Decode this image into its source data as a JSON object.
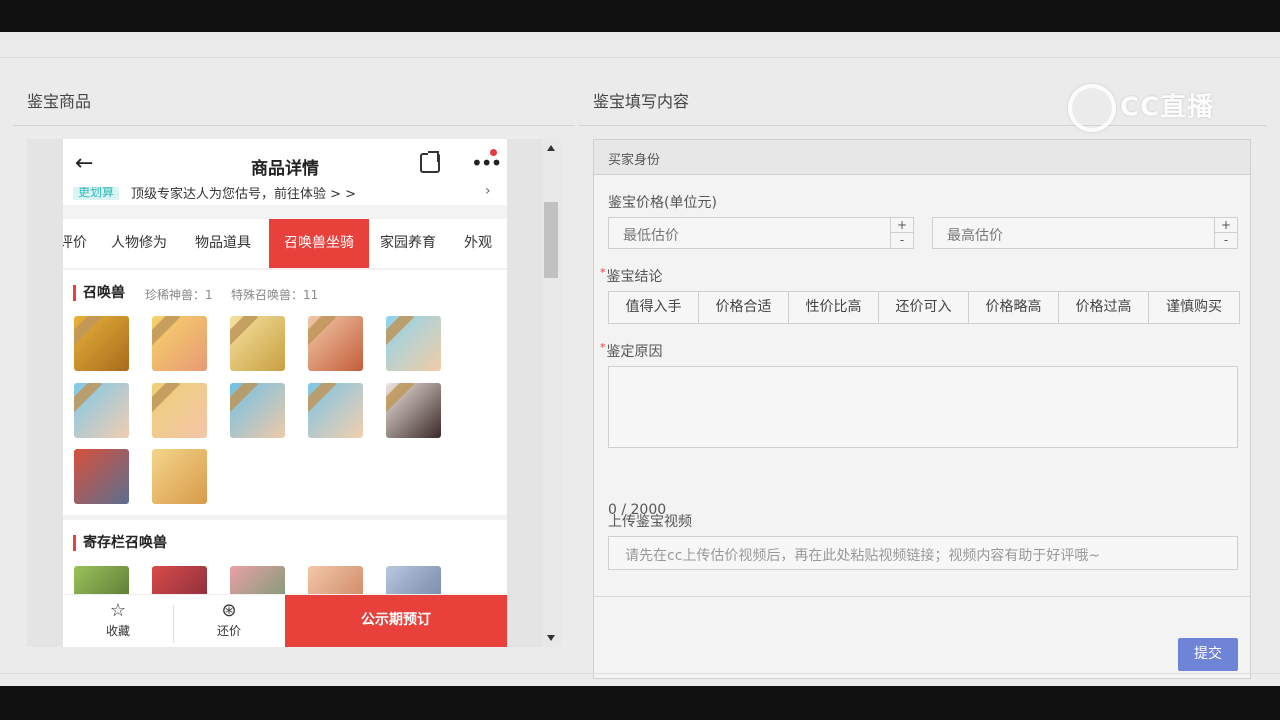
{
  "left_section": {
    "title": "鉴宝商品"
  },
  "right_section": {
    "title": "鉴宝填写内容"
  },
  "watermark": {
    "text": "CC直播"
  },
  "phone": {
    "nav_title": "商品详情",
    "promo": {
      "badge": "更划算",
      "text": "顶级专家达人为您估号，前往体验 > >",
      "chevron": "›"
    },
    "tabs": [
      "评价",
      "人物修为",
      "物品道具",
      "召唤兽坐骑",
      "家园养育",
      "外观"
    ],
    "active_tab": "召唤兽坐骑",
    "summon_card": {
      "title": "召唤兽",
      "rare_label": "珍稀神兽：1",
      "special_label": "特殊召唤兽：11"
    },
    "storage_card": {
      "title": "寄存栏召唤兽"
    },
    "bottom": {
      "favorite": "收藏",
      "bargain": "还价",
      "cta": "公示期预订"
    }
  },
  "form": {
    "header": "买家身份",
    "price_label": "鉴宝价格(单位元)",
    "min_placeholder": "最低估价",
    "max_placeholder": "最高估价",
    "plus": "+",
    "minus": "-",
    "conclusion_label": "鉴宝结论",
    "conclusions": [
      "值得入手",
      "价格合适",
      "性价比高",
      "还价可入",
      "价格略高",
      "价格过高",
      "谨慎购买"
    ],
    "reason_label": "鉴定原因",
    "counter": "0 / 2000",
    "video_label": "上传鉴宝视频",
    "video_placeholder": "请先在cc上传估价视频后，再在此处粘贴视频链接；视频内容有助于好评哦~",
    "submit": "提交",
    "required_mark": "*"
  },
  "colors": {
    "accent_red": "#e8413c",
    "submit_blue": "#6f84d6"
  },
  "icons": [
    "back-arrow-icon",
    "share-icon",
    "more-icon",
    "star-icon",
    "coin-icon",
    "scroll-up-icon",
    "scroll-down-icon"
  ]
}
